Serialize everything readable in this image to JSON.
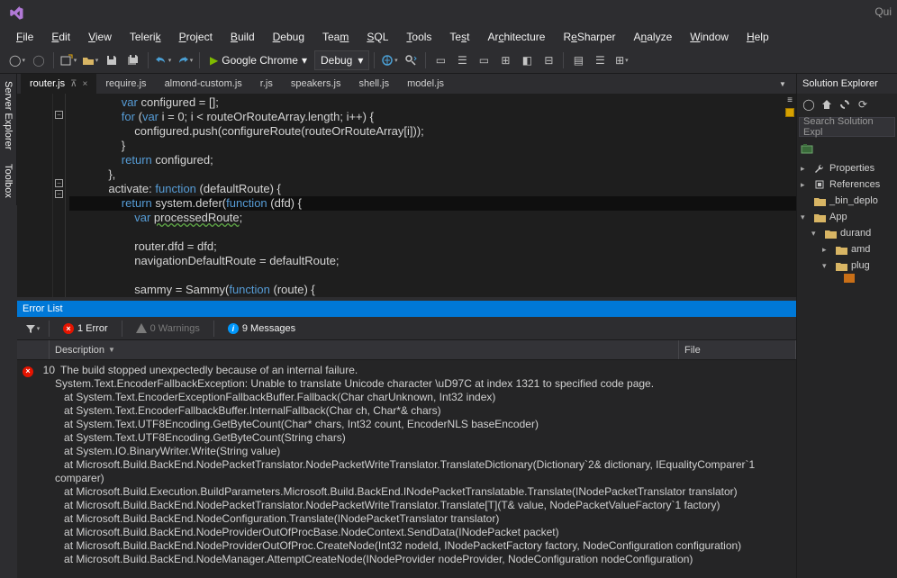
{
  "titlebar": {
    "quick_launch": "Qui"
  },
  "menu": {
    "file": "File",
    "edit": "Edit",
    "view": "View",
    "telerik": "Telerik",
    "project": "Project",
    "build": "Build",
    "debug": "Debug",
    "team": "Team",
    "sql": "SQL",
    "tools": "Tools",
    "test": "Test",
    "architecture": "Architecture",
    "resharper": "ReSharper",
    "analyze": "Analyze",
    "window": "Window",
    "help": "Help"
  },
  "toolbar": {
    "run_target": "Google Chrome",
    "config": "Debug"
  },
  "side_tabs": {
    "server_explorer": "Server Explorer",
    "toolbox": "Toolbox"
  },
  "tabs": [
    {
      "name": "router.js",
      "active": true
    },
    {
      "name": "require.js"
    },
    {
      "name": "almond-custom.js"
    },
    {
      "name": "r.js"
    },
    {
      "name": "speakers.js"
    },
    {
      "name": "shell.js"
    },
    {
      "name": "model.js"
    }
  ],
  "code_lines": [
    {
      "indent": 4,
      "segs": [
        {
          "t": "var ",
          "c": "kw"
        },
        {
          "t": "configured = [];",
          "c": "pln"
        }
      ]
    },
    {
      "indent": 4,
      "segs": [
        {
          "t": "for ",
          "c": "kw"
        },
        {
          "t": "(",
          "c": "pln"
        },
        {
          "t": "var ",
          "c": "kw"
        },
        {
          "t": "i = 0; i < routeOrRouteArray.length; i++) {",
          "c": "pln"
        }
      ]
    },
    {
      "indent": 5,
      "segs": [
        {
          "t": "configured.push(configureRoute(routeOrRouteArray[i]));",
          "c": "pln"
        }
      ]
    },
    {
      "indent": 4,
      "segs": [
        {
          "t": "}",
          "c": "pln"
        }
      ]
    },
    {
      "indent": 4,
      "segs": [
        {
          "t": "return ",
          "c": "kw"
        },
        {
          "t": "configured;",
          "c": "pln"
        }
      ]
    },
    {
      "indent": 3,
      "segs": [
        {
          "t": "},",
          "c": "pln"
        }
      ]
    },
    {
      "indent": 3,
      "segs": [
        {
          "t": "activate: ",
          "c": "pln"
        },
        {
          "t": "function ",
          "c": "kw"
        },
        {
          "t": "(defaultRoute) {",
          "c": "pln"
        }
      ]
    },
    {
      "indent": 4,
      "hl": true,
      "segs": [
        {
          "t": "return ",
          "c": "kw"
        },
        {
          "t": "system.defer(",
          "c": "pln"
        },
        {
          "t": "function ",
          "c": "kw"
        },
        {
          "t": "(dfd) {",
          "c": "pln"
        }
      ]
    },
    {
      "indent": 5,
      "segs": [
        {
          "t": "var ",
          "c": "kw"
        },
        {
          "t": "processedRoute",
          "c": "pln",
          "warn": true
        },
        {
          "t": ";",
          "c": "pln"
        }
      ]
    },
    {
      "indent": 5,
      "segs": [
        {
          "t": "",
          "c": "pln"
        }
      ]
    },
    {
      "indent": 5,
      "segs": [
        {
          "t": "router.dfd = dfd;",
          "c": "pln"
        }
      ]
    },
    {
      "indent": 5,
      "segs": [
        {
          "t": "navigationDefaultRoute = defaultRoute;",
          "c": "pln"
        }
      ]
    },
    {
      "indent": 5,
      "segs": [
        {
          "t": "",
          "c": "pln"
        }
      ]
    },
    {
      "indent": 5,
      "segs": [
        {
          "t": "sammy = Sammy(",
          "c": "pln"
        },
        {
          "t": "function ",
          "c": "kw"
        },
        {
          "t": "(route) {",
          "c": "pln"
        }
      ]
    }
  ],
  "error_list": {
    "title": "Error List",
    "filters": {
      "errors": "1 Error",
      "warnings": "0 Warnings",
      "messages": "9 Messages"
    },
    "columns": {
      "description": "Description",
      "file": "File"
    },
    "item": {
      "index": "10",
      "summary": "The build stopped unexpectedly because of an internal failure.",
      "trace": [
        "System.Text.EncoderFallbackException: Unable to translate Unicode character \\uD97C at index 1321 to specified code page.",
        "   at System.Text.EncoderExceptionFallbackBuffer.Fallback(Char charUnknown, Int32 index)",
        "   at System.Text.EncoderFallbackBuffer.InternalFallback(Char ch, Char*& chars)",
        "   at System.Text.UTF8Encoding.GetByteCount(Char* chars, Int32 count, EncoderNLS baseEncoder)",
        "   at System.Text.UTF8Encoding.GetByteCount(String chars)",
        "   at System.IO.BinaryWriter.Write(String value)",
        "   at Microsoft.Build.BackEnd.NodePacketTranslator.NodePacketWriteTranslator.TranslateDictionary(Dictionary`2& dictionary, IEqualityComparer`1 comparer)",
        "   at Microsoft.Build.Execution.BuildParameters.Microsoft.Build.BackEnd.INodePacketTranslatable.Translate(INodePacketTranslator translator)",
        "   at Microsoft.Build.BackEnd.NodePacketTranslator.NodePacketWriteTranslator.Translate[T](T& value, NodePacketValueFactory`1 factory)",
        "   at Microsoft.Build.BackEnd.NodeConfiguration.Translate(INodePacketTranslator translator)",
        "   at Microsoft.Build.BackEnd.NodeProviderOutOfProcBase.NodeContext.SendData(INodePacket packet)",
        "   at Microsoft.Build.BackEnd.NodeProviderOutOfProc.CreateNode(Int32 nodeId, INodePacketFactory factory, NodeConfiguration configuration)",
        "   at Microsoft.Build.BackEnd.NodeManager.AttemptCreateNode(INodeProvider nodeProvider, NodeConfiguration nodeConfiguration)"
      ]
    }
  },
  "solution_explorer": {
    "title": "Solution Explorer",
    "search_placeholder": "Search Solution Expl",
    "tree": [
      {
        "depth": 0,
        "exp": "▸",
        "icon": "wrench",
        "label": "Properties"
      },
      {
        "depth": 0,
        "exp": "▸",
        "icon": "ref",
        "label": "References"
      },
      {
        "depth": 0,
        "exp": "",
        "icon": "folder",
        "label": "_bin_deplo"
      },
      {
        "depth": 0,
        "exp": "▾",
        "icon": "folder",
        "label": "App"
      },
      {
        "depth": 1,
        "exp": "▾",
        "icon": "folder",
        "label": "durand"
      },
      {
        "depth": 2,
        "exp": "▸",
        "icon": "folder",
        "label": "amd"
      },
      {
        "depth": 2,
        "exp": "▾",
        "icon": "folder",
        "label": "plug"
      }
    ]
  }
}
